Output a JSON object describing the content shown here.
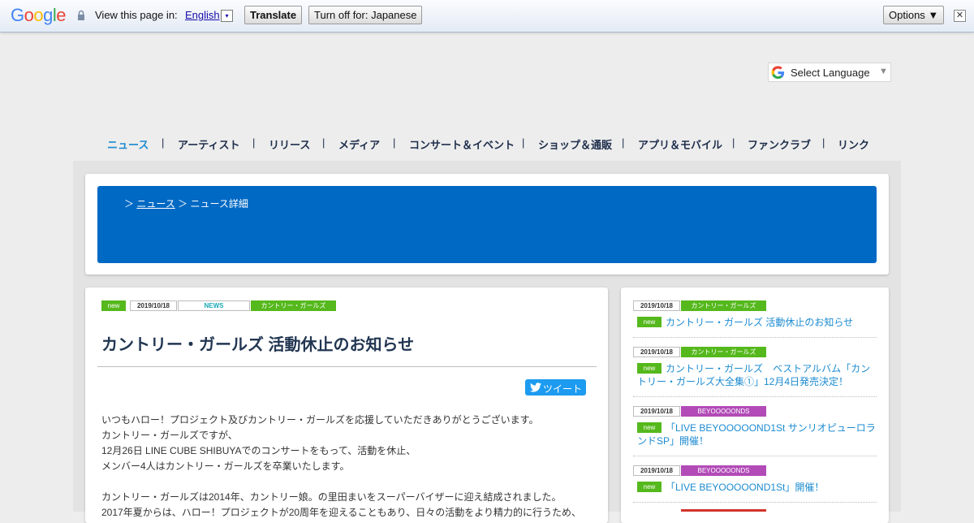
{
  "translate_bar": {
    "logo": "Google",
    "view_text": "View this page in:",
    "language": "English",
    "dropdown_glyph": "▾",
    "translate_button": "Translate",
    "turn_off_button": "Turn off for: Japanese",
    "options_button": "Options ▼",
    "close_glyph": "✕"
  },
  "select_language": {
    "label": "Select Language",
    "arrow": "▼"
  },
  "nav": {
    "items": [
      "ニュース",
      "アーティスト",
      "リリース",
      "メディア",
      "コンサート＆イベント",
      "ショップ＆通販",
      "アプリ＆モバイル",
      "ファンクラブ",
      "リンク"
    ],
    "separator": "|",
    "active_index": 0
  },
  "breadcrumb": {
    "prefix": "＞",
    "news_link": "ニュース",
    "sep": "＞",
    "current": "ニュース詳細"
  },
  "article": {
    "tags": {
      "new": "new",
      "date": "2019/10/18",
      "category": "NEWS",
      "group": "カントリー・ガールズ"
    },
    "title": "カントリー・ガールズ 活動休止のお知らせ",
    "tweet_label": "ツイート",
    "paragraphs": [
      "いつもハロー！プロジェクト及びカントリー・ガールズを応援していただきありがとうございます。",
      "カントリー・ガールズですが、",
      "12月26日 LINE CUBE SHIBUYAでのコンサートをもって、活動を休止、",
      "メンバー4人はカントリー・ガールズを卒業いたします。",
      "カントリー・ガールズは2014年、カントリー娘。の里田まいをスーパーバイザーに迎え結成されました。",
      "2017年夏からは、ハロー！プロジェクトが20周年を迎えることもあり、日々の活動をより精力的に行うため、"
    ]
  },
  "sidebar": {
    "items": [
      {
        "date": "2019/10/18",
        "group": "カントリー・ガールズ",
        "group_color": "#55b81c",
        "new": "new",
        "title_lines": [
          "カントリー・ガールズ 活動休止のお知らせ"
        ]
      },
      {
        "date": "2019/10/18",
        "group": "カントリー・ガールズ",
        "group_color": "#55b81c",
        "new": "new",
        "title_lines": [
          "カントリー・ガールズ　ベストアルバム「カン",
          "トリー・ガールズ大全集①」12月4日発売決定！"
        ]
      },
      {
        "date": "2019/10/18",
        "group": "BEYOOOOONDS",
        "group_color": "#b24bb7",
        "new": "new",
        "title_lines": [
          "「LIVE BEYOOOOOND1St サンリオピューロラ",
          "ンドSP」開催！"
        ]
      },
      {
        "date": "2019/10/18",
        "group": "BEYOOOOONDS",
        "group_color": "#b24bb7",
        "new": "new",
        "title_lines": [
          "「LIVE BEYOOOOOND1St」開催！"
        ]
      }
    ]
  },
  "colors": {
    "accent": "#0069c4",
    "link": "#1b8bd0",
    "new_green": "#55b81c",
    "beyooooonds_purple": "#b24bb7"
  },
  "icons": [
    "lock-icon",
    "google-g-icon",
    "twitter-bird-icon"
  ]
}
